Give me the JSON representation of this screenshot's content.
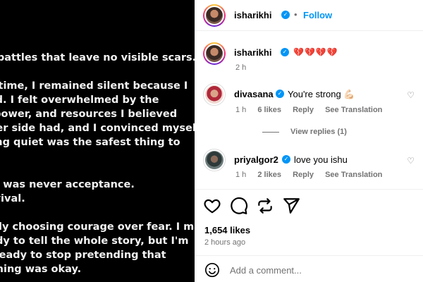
{
  "post_image": {
    "lines": [
      "re are battles that leave no visible scars.",
      "",
      "a long time, I remained silent because I",
      "s afraid. I felt overwhelmed by the",
      "ence, power, and resources I believed",
      "he other side had, and I convinced myself",
      "t staying quiet was the safest thing to",
      "",
      "",
      "silence was never acceptance.",
      "as survival.",
      "",
      "m finally choosing courage over fear. I may",
      "be ready to tell the whole story, but I'm",
      "inally ready to stop pretending that",
      "everything was okay."
    ]
  },
  "header": {
    "username": "isharikhi",
    "separator": "•",
    "follow_label": "Follow",
    "menu_icon": "more-horizontal-icon"
  },
  "caption": {
    "username": "isharikhi",
    "text": "💔💔💔💔",
    "time": "2 h"
  },
  "comments": [
    {
      "username": "divasana",
      "text": "You're strong 💪🏻",
      "time": "1 h",
      "likes": "6 likes",
      "reply": "Reply",
      "translate": "See Translation"
    },
    {
      "username": "priyalgor2",
      "text": "love you ishu",
      "time": "1 h",
      "likes": "2 likes",
      "reply": "Reply",
      "translate": "See Translation"
    }
  ],
  "view_replies": "View replies (1)",
  "post_stats": {
    "likes": "1,654 likes",
    "time_ago": "2 hours ago"
  },
  "add_comment": {
    "placeholder": "Add a comment..."
  },
  "colors": {
    "accent": "#0095f6",
    "muted": "#737373",
    "heart": "#e0245e"
  }
}
